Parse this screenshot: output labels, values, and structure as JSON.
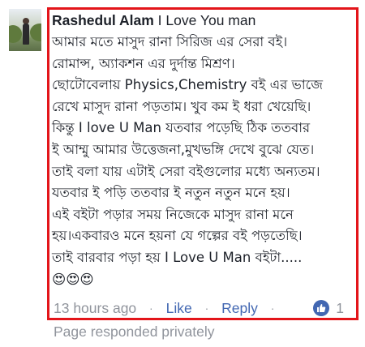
{
  "comment": {
    "author": "Rashedul Alam",
    "title_separator": "I",
    "title": "Love You man",
    "lines": [
      " আমার মতে মাসুদ রানা সিরিজ এর সেরা বই।",
      "রোমান্স, অ্যাকশন এর দুর্দান্ত মিশ্রণ।",
      "ছোটোবেলায় Physics,Chemistry  বই এর ভাজে",
      "রেখে মাসুদ রানা পড়তাম। খুব কম ই ধরা খেয়েছি।",
      "কিন্তু I love U Man  যতবার পড়েছি ঠিক ততবার",
      "ই আম্মু আমার উত্তেজনা,মুখভঙ্গি দেখে বুঝে যেত।",
      "তাই বলা যায় এটাই সেরা বইগুলোর মধ্যে অন্যতম।",
      "যতবার ই পড়ি ততবার ই নতুন নতুন মনে হয়।",
      "এই বইটা পড়ার সময় নিজেকে মাসুদ রানা মনে",
      "হয়।একবারও মনে হয়না যে গল্পের বই পড়তেছি।",
      "তাই বারবার পড়া হয় I Love U Man বইটা.....",
      "😍😍😍"
    ]
  },
  "actions": {
    "timestamp": "13 hours ago",
    "separator": "·",
    "like_label": "Like",
    "reply_label": "Reply",
    "reaction_icon": "thumbs-up-icon",
    "reaction_count": "1"
  },
  "footer_note": "Page responded privately",
  "colors": {
    "highlight": "#e3151a",
    "link": "#4267b2",
    "muted": "#90949c",
    "text": "#1d2129"
  }
}
